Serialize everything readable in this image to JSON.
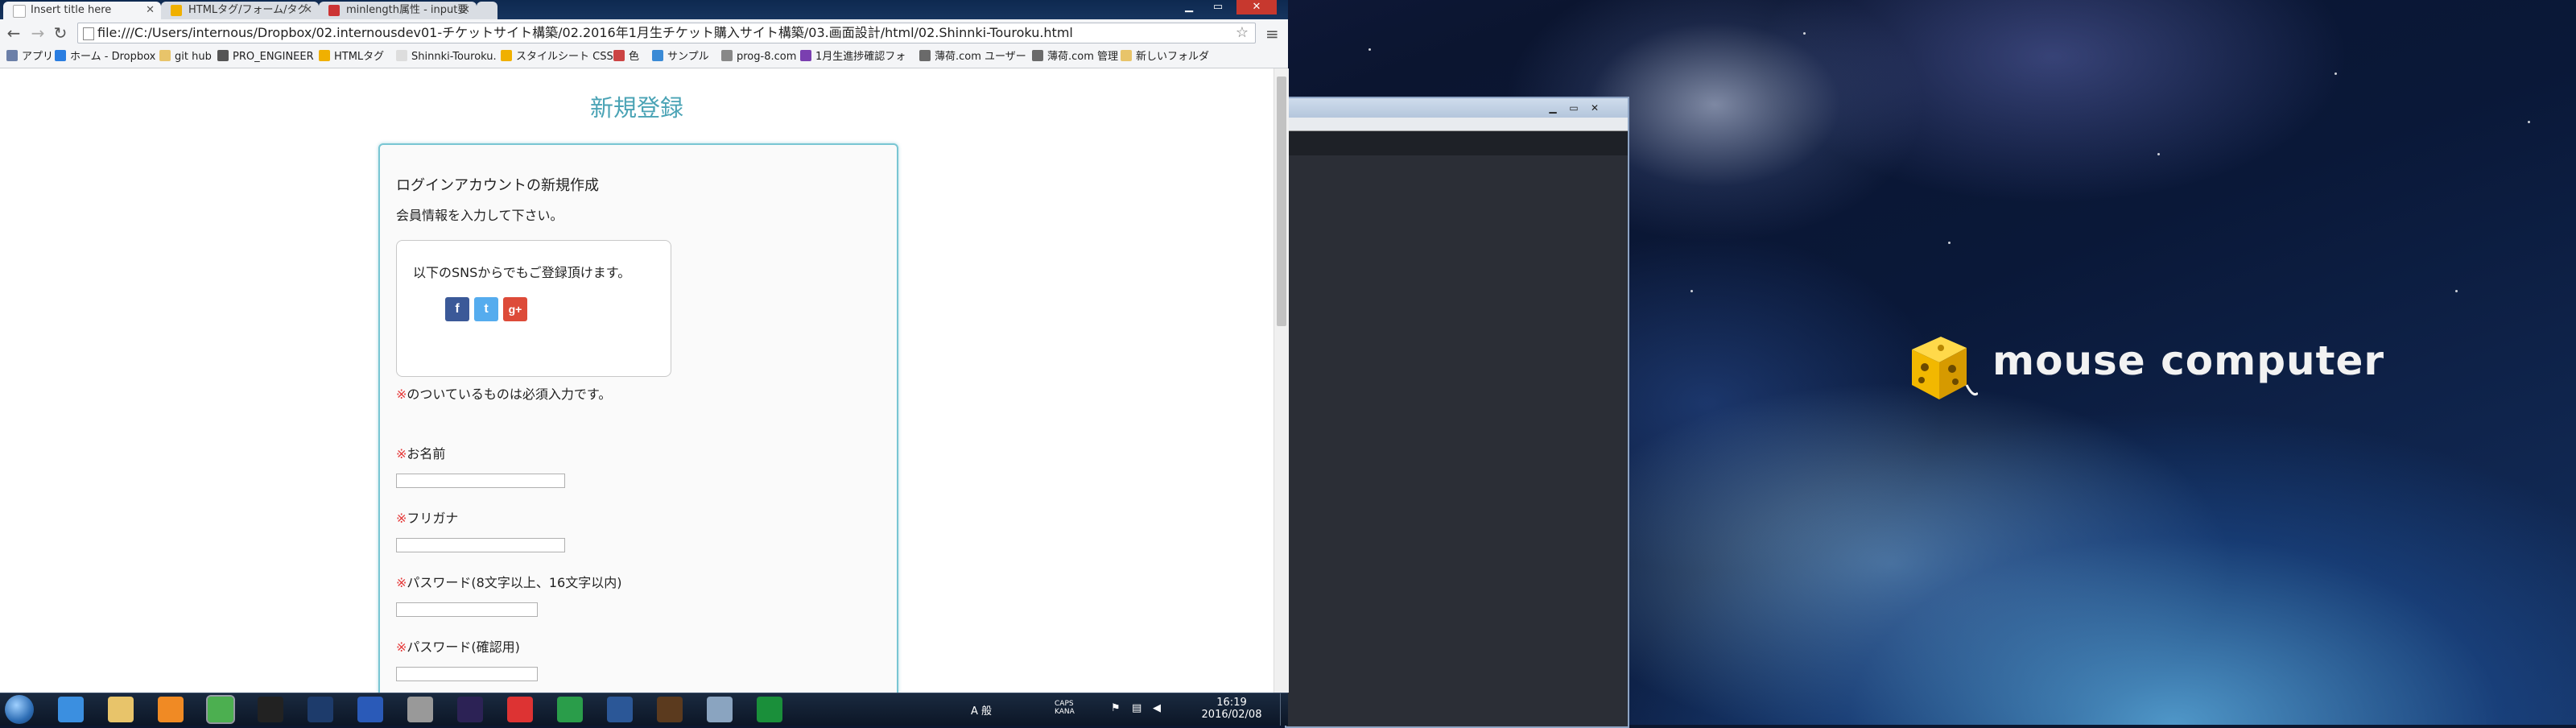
{
  "browser": {
    "tabs": [
      {
        "title": "Insert title here",
        "active": true
      },
      {
        "title": "HTMLタグ/フォーム/タグ",
        "active": false
      },
      {
        "title": "minlength属性 - input要",
        "active": false
      }
    ],
    "window_controls": {
      "minimize": "▁",
      "maximize": "▭",
      "close": "✕"
    },
    "url": "file:///C:/Users/internous/Dropbox/02.internousdev01-チケットサイト構築/02.2016年1月生チケット購入サイト構築/03.画面設計/html/02.Shinnki-Touroku.html",
    "nav": {
      "back": "←",
      "forward": "→",
      "reload": "↻",
      "star": "☆",
      "menu": "≡"
    },
    "bookmarks": [
      {
        "label": "アプリ",
        "color": "#6b7fa8"
      },
      {
        "label": "ホーム - Dropbox",
        "color": "#2a7de1"
      },
      {
        "label": "git hub",
        "color": "#e8c46a"
      },
      {
        "label": "PRO_ENGINEER",
        "color": "#555555"
      },
      {
        "label": "HTMLタグ",
        "color": "#f0b000"
      },
      {
        "label": "Shinnki-Touroku.",
        "color": "#dddddd"
      },
      {
        "label": "スタイルシート CSS",
        "color": "#f0b000"
      },
      {
        "label": "色",
        "color": "#cc4444"
      },
      {
        "label": "サンプル",
        "color": "#3a8ad6"
      },
      {
        "label": "prog-8.com",
        "color": "#888888"
      },
      {
        "label": "1月生進捗確認フォ",
        "color": "#7a3fb0"
      },
      {
        "label": "薄荷.com ユーザー",
        "color": "#6a6a6a"
      },
      {
        "label": "薄荷.com 管理",
        "color": "#6a6a6a"
      },
      {
        "label": "新しいフォルダ",
        "color": "#e8c46a"
      }
    ]
  },
  "page": {
    "title": "新規登録",
    "heading": "ログインアカウントの新規作成",
    "intro": "会員情報を入力して下さい。",
    "sns_text": "以下のSNSからでもご登録頂けます。",
    "sns": [
      {
        "name": "facebook",
        "glyph": "f",
        "color": "#3b5998"
      },
      {
        "name": "twitter",
        "glyph": "t",
        "color": "#55acee"
      },
      {
        "name": "google-plus",
        "glyph": "g+",
        "color": "#dd4b39"
      }
    ],
    "required_mark": "※",
    "required_note": "のついているものは必須入力です。",
    "fields": [
      {
        "label": "お名前",
        "value": ""
      },
      {
        "label": "フリガナ",
        "value": ""
      },
      {
        "label": "パスワード(8文字以上、16文字以内)",
        "value": ""
      },
      {
        "label": "パスワード(確認用)",
        "value": ""
      }
    ]
  },
  "desktop": {
    "brand_text": "mouse computer",
    "brand_color": "#f5c400"
  },
  "taskbar": {
    "apps": [
      {
        "name": "internet-explorer",
        "color": "#3b8fe0"
      },
      {
        "name": "explorer",
        "color": "#e8c46a"
      },
      {
        "name": "media-player",
        "color": "#f08a24"
      },
      {
        "name": "chrome",
        "color": "#4caf50",
        "active": true
      },
      {
        "name": "console",
        "color": "#222222"
      },
      {
        "name": "terminal",
        "color": "#1d3b6b"
      },
      {
        "name": "ac-app",
        "color": "#2a5ab8"
      },
      {
        "name": "tool-app",
        "color": "#999999"
      },
      {
        "name": "eclipse",
        "color": "#2c2255"
      },
      {
        "name": "red-app",
        "color": "#d33"
      },
      {
        "name": "green-app",
        "color": "#2a9d4a"
      },
      {
        "name": "word",
        "color": "#2b5797"
      },
      {
        "name": "photo-app",
        "color": "#5b3a1e"
      },
      {
        "name": "folder-app",
        "color": "#8aa4c0"
      },
      {
        "name": "s-app",
        "color": "#1a8f3a"
      }
    ],
    "tray_ime": "A 般",
    "tray_caps": "CAPS KANA",
    "time": "16:19",
    "date": "2016/02/08"
  }
}
